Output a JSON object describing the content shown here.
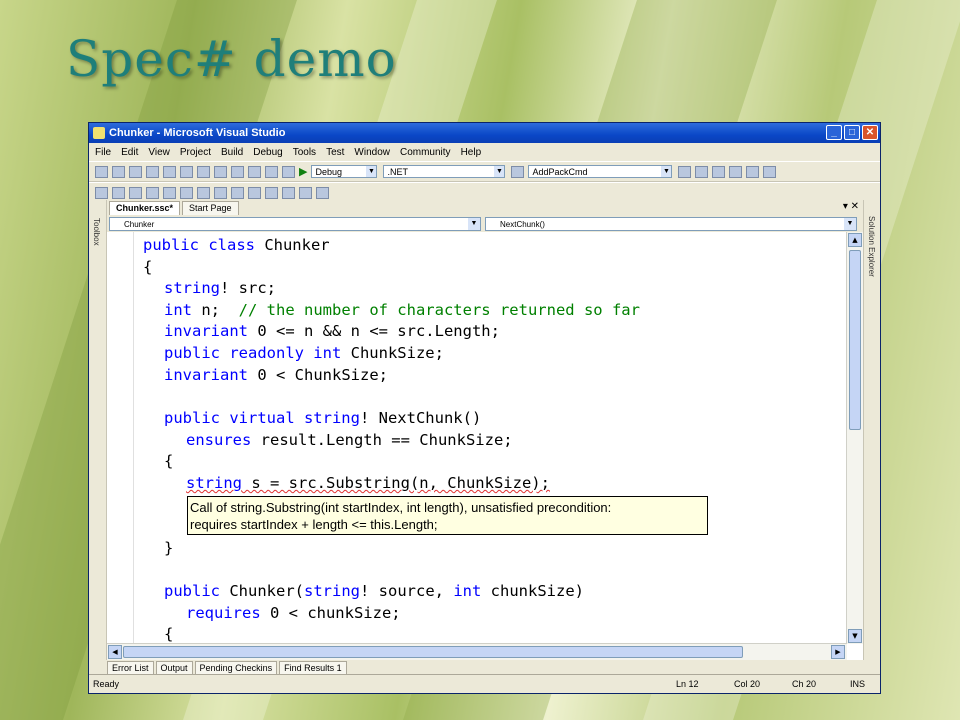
{
  "slide": {
    "title": "Spec# demo"
  },
  "window": {
    "title": "Chunker - Microsoft Visual Studio",
    "min": "_",
    "max": "□",
    "close": "✕"
  },
  "menu": [
    "File",
    "Edit",
    "View",
    "Project",
    "Build",
    "Debug",
    "Tools",
    "Test",
    "Window",
    "Community",
    "Help"
  ],
  "toolbar": {
    "config": "Debug",
    "platform": ".NET",
    "find": "AddPackCmd"
  },
  "side": {
    "left": "Toolbox",
    "right": "Solution Explorer"
  },
  "tabs": {
    "active": "Chunker.ssc*",
    "other": "Start Page"
  },
  "nav": {
    "class": "Chunker",
    "member": "NextChunk()"
  },
  "code": {
    "l1a": "public class",
    "l1b": " Chunker",
    "l2": "{",
    "l3a": "string",
    "l3b": "! src;",
    "l4a": "int",
    "l4b": " n;  ",
    "l4c": "// the number of characters returned so far",
    "l5a": "invariant",
    "l5b": " 0 <= n && n <= src.Length;",
    "l6a": "public readonly int",
    "l6b": " ChunkSize;",
    "l7a": "invariant",
    "l7b": " 0 < ChunkSize;",
    "l8a": "public virtual string",
    "l8b": "! NextChunk()",
    "l9a": "ensures",
    "l9b": " result.Length == ChunkSize;",
    "l10": "{",
    "l11a": "string",
    "l11b": " s = src.Substring(n, ChunkSize);",
    "l12": "}",
    "l13a": "public",
    "l13b": " Chunker(",
    "l13c": "string",
    "l13d": "! source, ",
    "l13e": "int",
    "l13f": " chunkSize)",
    "l14a": "requires",
    "l14b": " 0 < chunkSize;",
    "l15": "{"
  },
  "tooltip": {
    "line1": "Call of string.Substring(int startIndex, int length), unsatisfied precondition:",
    "line2": "requires startIndex + length <= this.Length;"
  },
  "bottom_tabs": [
    "Error List",
    "Output",
    "Pending Checkins",
    "Find Results 1"
  ],
  "status": {
    "ready": "Ready",
    "ln": "Ln 12",
    "col": "Col 20",
    "ch": "Ch 20",
    "ins": "INS"
  }
}
